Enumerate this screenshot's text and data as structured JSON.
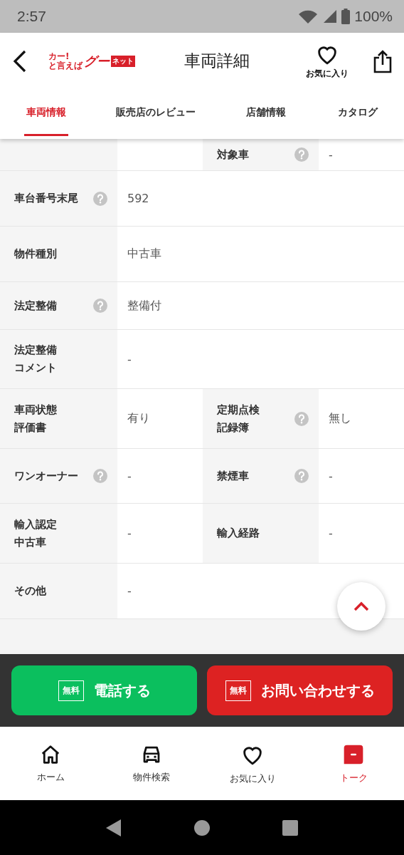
{
  "status_bar": {
    "time": "2:57",
    "battery": "100%"
  },
  "header": {
    "title": "車両詳細",
    "logo": [
      "カー!",
      "と言えば",
      "グー",
      "ネット"
    ],
    "favorite_label": "お気に入り"
  },
  "tabs": [
    {
      "label": "車両情報",
      "selected": true
    },
    {
      "label": "販売店のレビュー",
      "selected": false
    },
    {
      "label": "店舗情報",
      "selected": false
    },
    {
      "label": "カタログ",
      "selected": false
    }
  ],
  "spec_rows": [
    {
      "cells": [
        {
          "help": false
        },
        {
          "label_lines": [
            "対象車"
          ],
          "help": true,
          "value": "-"
        }
      ]
    },
    {
      "cells": [
        {
          "label_lines": [
            "車台番号末尾"
          ],
          "help": true,
          "value": "592"
        }
      ]
    },
    {
      "cells": [
        {
          "label_lines": [
            "物件種別"
          ],
          "help": false,
          "value": "中古車"
        }
      ]
    },
    {
      "cells": [
        {
          "label_lines": [
            "法定整備"
          ],
          "help": true,
          "value": "整備付"
        }
      ]
    },
    {
      "cells": [
        {
          "label_lines": [
            "法定整備",
            "コメント"
          ],
          "help": false,
          "value": "-"
        }
      ]
    },
    {
      "cells": [
        {
          "label_lines": [
            "車両状態",
            "評価書"
          ],
          "help": false,
          "value": "有り"
        },
        {
          "label_lines": [
            "定期点検",
            "記録簿"
          ],
          "help": true,
          "value": "無し"
        }
      ]
    },
    {
      "cells": [
        {
          "label_lines": [
            "ワンオーナー"
          ],
          "help": true,
          "value": "-"
        },
        {
          "label_lines": [
            "禁煙車"
          ],
          "help": true,
          "value": "-"
        }
      ]
    },
    {
      "cells": [
        {
          "label_lines": [
            "輸入認定",
            "中古車"
          ],
          "help": false,
          "value": "-"
        },
        {
          "label_lines": [
            "輸入経路"
          ],
          "help": false,
          "value": "-"
        }
      ]
    },
    {
      "cells": [
        {
          "label_lines": [
            "その他"
          ],
          "help": false,
          "value": "-"
        }
      ]
    }
  ],
  "actions": [
    {
      "kind": "phone",
      "badge": "無料",
      "label": "電話する"
    },
    {
      "kind": "inquiry",
      "badge": "無料",
      "label": "お問い合わせする"
    }
  ],
  "bottom_nav": [
    {
      "label": "ホーム",
      "selected": false
    },
    {
      "label": "物件検索",
      "selected": false
    },
    {
      "label": "お気に入り",
      "selected": false
    },
    {
      "label": "トーク",
      "selected": true
    }
  ]
}
